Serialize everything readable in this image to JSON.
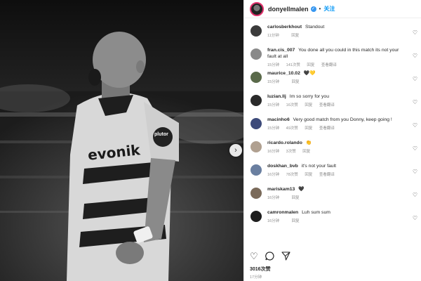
{
  "post": {
    "username": "donyellmalen",
    "follow_label": "关注",
    "likes_label": "3016次赞",
    "time_label": "17分钟"
  },
  "photo": {
    "jersey_text": "evonik",
    "badge_text": "plutor"
  },
  "comments": [
    {
      "user": "carlosberkhout",
      "text": "Standout",
      "time": "11分钟",
      "likes": "",
      "reply": "回复",
      "translate": "",
      "avatar_color": "#3b3b3b"
    },
    {
      "user": "fran.cis_007",
      "text": "You done all you could in this match its not your fault at all",
      "time": "15分钟",
      "likes": "141次赞",
      "reply": "回复",
      "translate": "查看翻译",
      "avatar_color": "#8a8a8a"
    },
    {
      "user": "maurice_10.02",
      "text": "🖤💛",
      "time": "15分钟",
      "likes": "",
      "reply": "回复",
      "translate": "",
      "avatar_color": "#5a6a4a"
    },
    {
      "user": "luzian.llj",
      "text": "Im so sorry for you",
      "time": "15分钟",
      "likes": "16次赞",
      "reply": "回复",
      "translate": "查看翻译",
      "avatar_color": "#2a2a2a"
    },
    {
      "user": "macinho6",
      "text": "Very good match from you Donny, keep going !",
      "time": "15分钟",
      "likes": "49次赞",
      "reply": "回复",
      "translate": "查看翻译",
      "avatar_color": "#3d4a7a"
    },
    {
      "user": "ricardo.rolando",
      "text": "👏",
      "time": "16分钟",
      "likes": "3次赞",
      "reply": "回复",
      "translate": "",
      "avatar_color": "#b0a090"
    },
    {
      "user": "doskhan_bvb",
      "text": "it's not your fault",
      "time": "16分钟",
      "likes": "78次赞",
      "reply": "回复",
      "translate": "查看翻译",
      "avatar_color": "#6a7fa0"
    },
    {
      "user": "mariskam13",
      "text": "🖤",
      "time": "16分钟",
      "likes": "",
      "reply": "回复",
      "translate": "",
      "avatar_color": "#7a6a5a"
    },
    {
      "user": "camronmalen",
      "text": "Luh sum sum",
      "time": "16分钟",
      "likes": "",
      "reply": "回复",
      "translate": "",
      "avatar_color": "#1e1e1e"
    }
  ],
  "icons": {
    "like": "♡",
    "comment": "◯",
    "share": "➤",
    "next": "›",
    "comment_heart": "♡"
  }
}
